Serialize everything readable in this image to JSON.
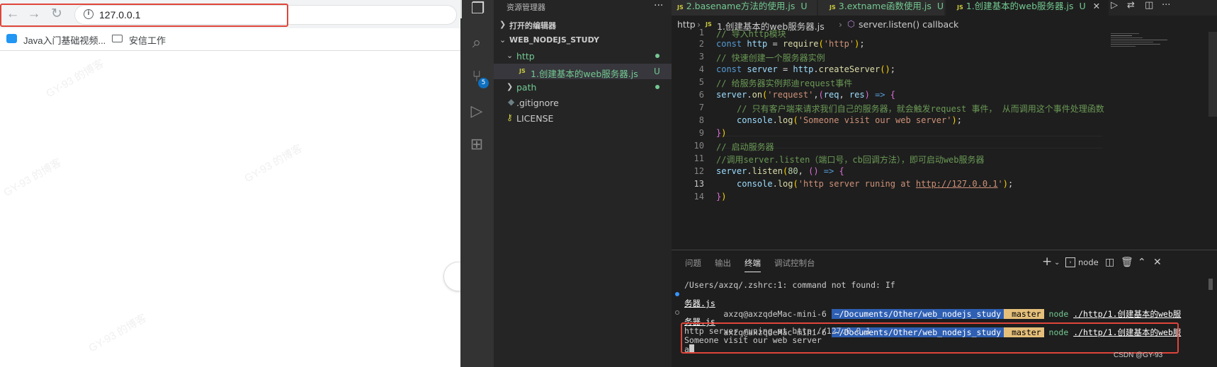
{
  "browser": {
    "url": "127.0.0.1",
    "nav": {
      "back": "←",
      "forward": "→",
      "reload": "↻"
    },
    "bookmarks": [
      {
        "label": "Java入门基础视频...",
        "icon": "bilibili-icon"
      },
      {
        "label": "安信工作",
        "icon": "folder-icon"
      }
    ],
    "watermark": "GY-93 的博客"
  },
  "explorer": {
    "title": "资源管理器",
    "open_editors": "打开的编辑器",
    "workspace": "WEB_NODEJS_STUDY",
    "items": [
      {
        "label": "http",
        "type": "folder",
        "expanded": true
      },
      {
        "label": "1.创建基本的web服务器.js",
        "type": "file",
        "badge": "U",
        "active": true
      },
      {
        "label": "path",
        "type": "folder",
        "expanded": false
      },
      {
        "label": ".gitignore",
        "type": "file"
      },
      {
        "label": "LICENSE",
        "type": "file"
      }
    ]
  },
  "activity": {
    "scm_badge": "5"
  },
  "tabs": [
    {
      "label": "2.basename方法的使用.js",
      "badge": "U"
    },
    {
      "label": "3.extname函数使用.js",
      "badge": "U"
    },
    {
      "label": "1.创建基本的web服务器.js",
      "badge": "U",
      "active": true
    }
  ],
  "breadcrumb": {
    "folder": "http",
    "file": "1.创建基本的web服务器.js",
    "symbol": "server.listen() callback"
  },
  "code": {
    "line_numbers": [
      "1",
      "2",
      "3",
      "4",
      "5",
      "6",
      "7",
      "8",
      "9",
      "10",
      "11",
      "12",
      "13",
      "14"
    ],
    "line1": "// 导入http模块",
    "line3": "// 快速创建一个服务器实例",
    "line5": "// 给服务器实例邦迪request事件",
    "line7": "// 只有客户端来请求我们自己的服务器，就会触发request 事件， 从而调用这个事件处理函数",
    "line10": "// 启动服务器",
    "line11": "//调用server.listen（端口号，cb回调方法），即可启动web服务器",
    "str_http": "'http'",
    "str_request": "'request'",
    "str_visit": "'Someone visit our web server'",
    "str_running_pre": "'http server runing at ",
    "str_running_url": "http://127.0.0.1",
    "str_running_post": "'",
    "port": "80"
  },
  "panel": {
    "tabs": [
      "问题",
      "输出",
      "终端",
      "调试控制台"
    ],
    "active_tab": "终端",
    "shell_label": "node",
    "terminal": {
      "line1": "/Users/axzq/.zshrc:1: command not found: If",
      "user": "axzq@axzqdeMac-mini-6",
      "path": "~/Documents/Other/web_nodejs_study",
      "branch": " master",
      "cmd": "node",
      "arg": "./http/1.创建基本的web服",
      "arg_cont": "务器.js",
      "out1": "http server runing at http://127.0.0.1",
      "out2": "Someone visit our web server",
      "input": "a"
    }
  },
  "credit": "CSDN @GY-93"
}
